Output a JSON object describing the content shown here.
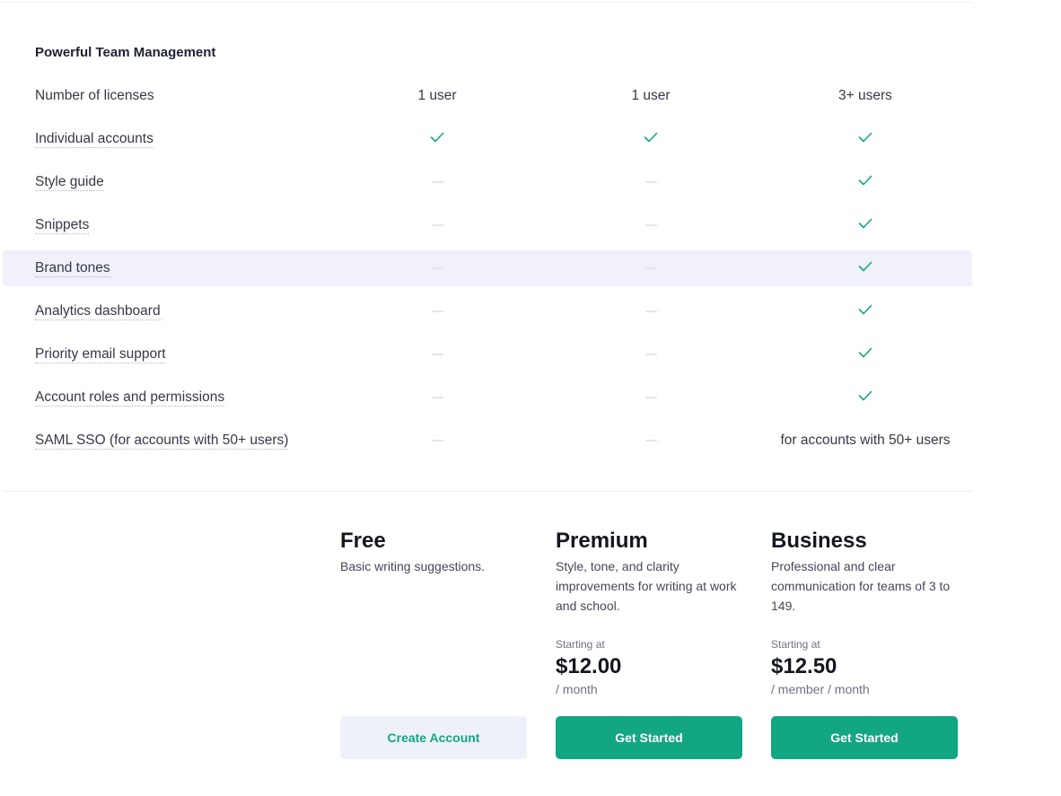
{
  "section": {
    "title": "Powerful Team Management"
  },
  "colors": {
    "accent": "#13a683",
    "highlight_row": "#f0f1fa",
    "secondary_button_bg": "#eff1fa"
  },
  "features": [
    {
      "label": "Number of licenses",
      "dotted": false,
      "values": [
        {
          "type": "text",
          "text": "1 user"
        },
        {
          "type": "text",
          "text": "1 user"
        },
        {
          "type": "text",
          "text": "3+ users"
        }
      ]
    },
    {
      "label": "Individual accounts",
      "dotted": true,
      "values": [
        {
          "type": "check"
        },
        {
          "type": "check"
        },
        {
          "type": "check"
        }
      ]
    },
    {
      "label": "Style guide",
      "dotted": true,
      "values": [
        {
          "type": "dash"
        },
        {
          "type": "dash"
        },
        {
          "type": "check"
        }
      ]
    },
    {
      "label": "Snippets",
      "dotted": true,
      "values": [
        {
          "type": "dash"
        },
        {
          "type": "dash"
        },
        {
          "type": "check"
        }
      ]
    },
    {
      "label": "Brand tones",
      "dotted": true,
      "highlighted": true,
      "values": [
        {
          "type": "dash"
        },
        {
          "type": "dash"
        },
        {
          "type": "check"
        }
      ]
    },
    {
      "label": "Analytics dashboard",
      "dotted": true,
      "values": [
        {
          "type": "dash"
        },
        {
          "type": "dash"
        },
        {
          "type": "check"
        }
      ]
    },
    {
      "label": "Priority email support",
      "dotted": true,
      "values": [
        {
          "type": "dash"
        },
        {
          "type": "dash"
        },
        {
          "type": "check"
        }
      ]
    },
    {
      "label": "Account roles and permissions",
      "dotted": true,
      "values": [
        {
          "type": "dash"
        },
        {
          "type": "dash"
        },
        {
          "type": "check"
        }
      ]
    },
    {
      "label": "SAML SSO (for accounts with 50+ users)",
      "dotted": true,
      "values": [
        {
          "type": "dash"
        },
        {
          "type": "dash"
        },
        {
          "type": "text",
          "text": "for accounts with 50+ users"
        }
      ]
    }
  ],
  "plans": [
    {
      "name": "Free",
      "description": "Basic writing suggestions.",
      "button": "Create Account"
    },
    {
      "name": "Premium",
      "description": "Style, tone, and clarity improvements for writing at work and school.",
      "starting_label": "Starting at",
      "price": "$12.00",
      "period": "/ month",
      "button": "Get Started"
    },
    {
      "name": "Business",
      "description": "Professional and clear communication for teams of 3 to 149.",
      "starting_label": "Starting at",
      "price": "$12.50",
      "period": "/ member / month",
      "button": "Get Started"
    }
  ]
}
